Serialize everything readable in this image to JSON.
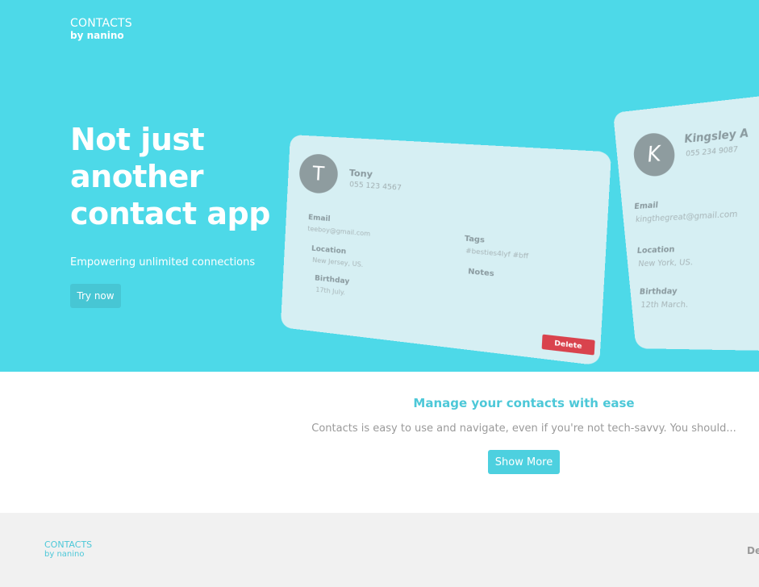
{
  "header": {
    "logo_title": "CONTACTS",
    "logo_sub": "by nanino"
  },
  "hero": {
    "headline": "Not just another contact app",
    "subhead": "Empowering unlimited connections",
    "cta": "Try now"
  },
  "cards": {
    "tony": {
      "initial": "T",
      "name": "Tony",
      "phone": "055 123 4567",
      "email_label": "Email",
      "email": "teeboy@gmail.com",
      "location_label": "Location",
      "location": "New Jersey, US.",
      "birthday_label": "Birthday",
      "birthday": "17th July.",
      "tags_label": "Tags",
      "tags": "#besties4lyf #bff",
      "notes_label": "Notes",
      "delete": "Delete"
    },
    "kingsley": {
      "initial": "K",
      "name": "Kingsley A",
      "phone": "055 234 9087",
      "email_label": "Email",
      "email": "kingthegreat@gmail.com",
      "location_label": "Location",
      "location": "New York, US.",
      "birthday_label": "Birthday",
      "birthday": "12th March."
    }
  },
  "features": {
    "title": "Manage your contacts with ease",
    "text": "Contacts is easy to use and navigate, even if you're not tech-savvy. You should...",
    "button": "Show More"
  },
  "footer": {
    "logo_title": "CONTACTS",
    "logo_sub": "by nanino",
    "right_text": "De"
  },
  "colors": {
    "brand": "#4dd9e8",
    "accent": "#4dc8d8",
    "danger": "#d9434d",
    "card": "#d6eff3"
  }
}
